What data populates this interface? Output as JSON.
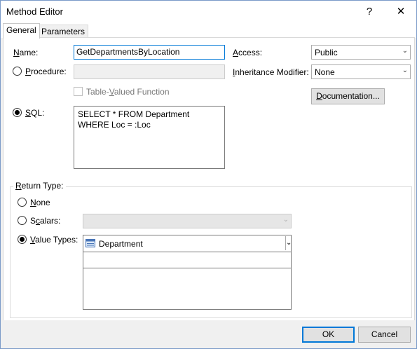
{
  "window": {
    "title": "Method Editor",
    "help_label": "?",
    "close_label": "✕"
  },
  "tabs": [
    {
      "label": "General",
      "active": true
    },
    {
      "label": "Parameters",
      "active": false
    }
  ],
  "name": {
    "label_u": "N",
    "label_rest": "ame:",
    "value": "GetDepartmentsByLocation"
  },
  "procedure": {
    "label_u": "P",
    "label_rest": "rocedure:",
    "value": ""
  },
  "table_valued": {
    "label_pre": "Table-",
    "label_u": "V",
    "label_rest": "alued Function"
  },
  "sql": {
    "label_u": "S",
    "label_rest": "QL:",
    "value": "SELECT * FROM Department WHERE Loc = :Loc"
  },
  "access": {
    "label_u": "A",
    "label_rest": "ccess:",
    "value": "Public"
  },
  "inheritance": {
    "label_u": "I",
    "label_rest": "nheritance Modifier:",
    "value": "None"
  },
  "documentation": {
    "label_u": "D",
    "label_rest": "ocumentation..."
  },
  "return_type": {
    "group_label_u": "R",
    "group_label_rest": "eturn Type:",
    "none": {
      "label_u": "N",
      "label_rest": "one"
    },
    "scalars": {
      "label_pre": "S",
      "label_u": "c",
      "label_rest": "alars:"
    },
    "value_types": {
      "label_u": "V",
      "label_rest": "alue Types:",
      "selected": "Department"
    }
  },
  "footer": {
    "ok": "OK",
    "cancel": "Cancel"
  }
}
